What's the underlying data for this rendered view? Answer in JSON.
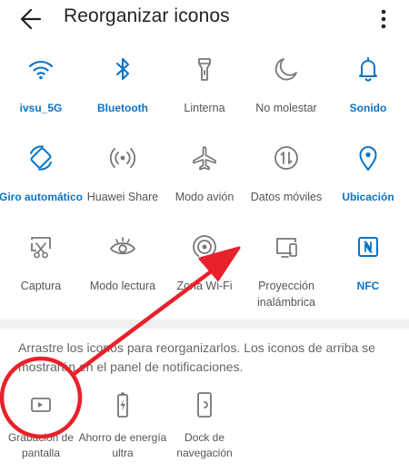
{
  "header": {
    "title": "Reorganizar iconos",
    "back_icon": "arrow-left-icon",
    "more_icon": "more-vertical-icon"
  },
  "colors": {
    "active": "#0a74c5",
    "inactive": "#777777",
    "annotation": "#e8212a"
  },
  "active_tiles": [
    {
      "label": "ivsu_5G",
      "icon": "wifi-icon"
    },
    {
      "label": "Bluetooth",
      "icon": "bluetooth-icon"
    },
    {
      "label": "Linterna",
      "icon": "flashlight-icon"
    },
    {
      "label": "No molestar",
      "icon": "moon-icon"
    },
    {
      "label": "Sonido",
      "icon": "bell-icon"
    },
    {
      "label": "Giro automático",
      "icon": "rotate-icon"
    },
    {
      "label": "Huawei Share",
      "icon": "share-waves-icon"
    },
    {
      "label": "Modo avión",
      "icon": "airplane-icon"
    },
    {
      "label": "Datos móviles",
      "icon": "mobile-data-icon"
    },
    {
      "label": "Ubicación",
      "icon": "location-icon"
    },
    {
      "label": "Captura",
      "icon": "screenshot-icon"
    },
    {
      "label": "Modo lectura",
      "icon": "eye-icon"
    },
    {
      "label": "Zona Wi-Fi",
      "icon": "hotspot-icon"
    },
    {
      "label": "Proyección inalámbrica",
      "icon": "projection-icon"
    },
    {
      "label": "NFC",
      "icon": "nfc-icon"
    }
  ],
  "hint": "Arrastre los iconos para reorganizarlos. Los iconos de arriba se mostrarán en el panel de notificaciones.",
  "inactive_tiles": [
    {
      "label": "Grabación de pantalla",
      "icon": "screen-record-icon"
    },
    {
      "label": "Ahorro de energía ultra",
      "icon": "battery-saver-icon"
    },
    {
      "label": "Dock de navegación",
      "icon": "nav-dock-icon"
    }
  ]
}
